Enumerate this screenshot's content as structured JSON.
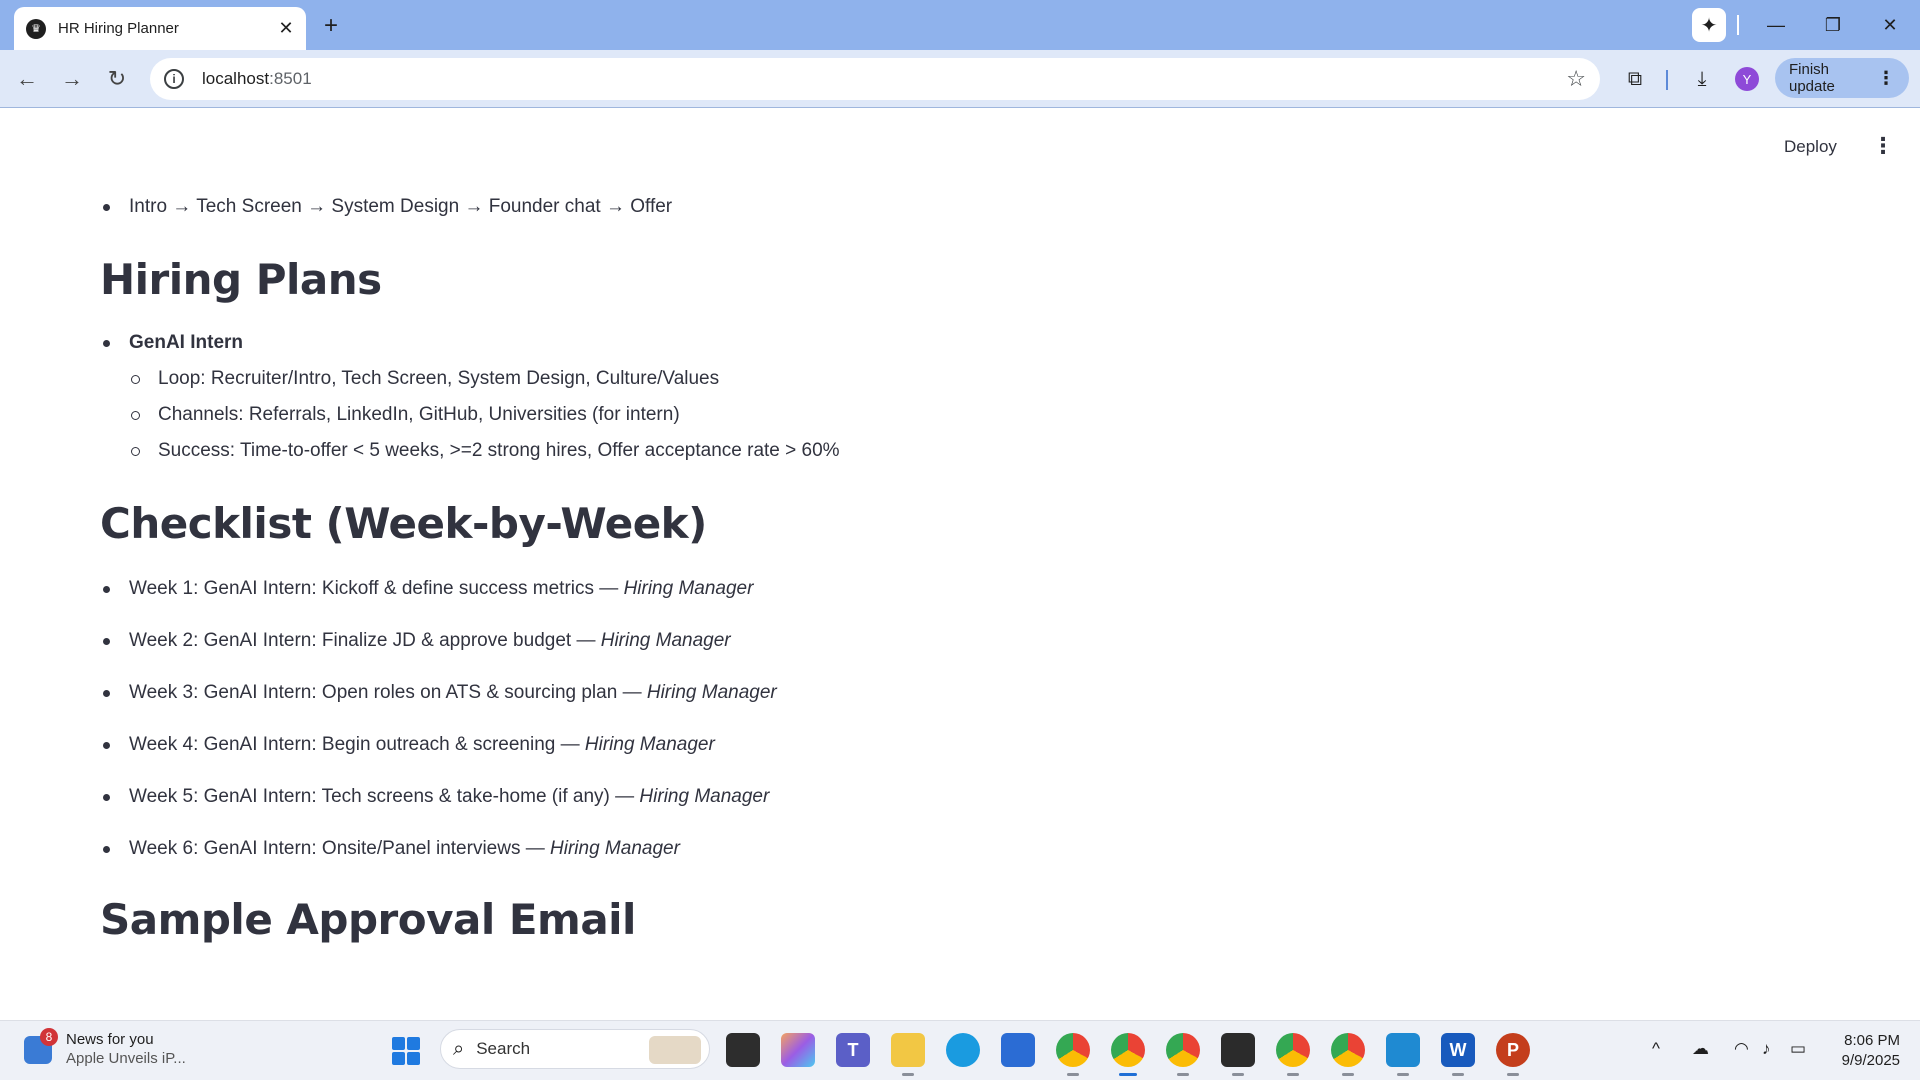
{
  "browser": {
    "tab_title": "HR Hiring Planner",
    "url_host": "localhost",
    "url_port": ":8501",
    "finish_update_label": "Finish update",
    "profile_initial": "Y"
  },
  "app": {
    "deploy_label": "Deploy",
    "process_line": "Intro → Tech Screen → System Design → Founder chat → Offer",
    "hiring_plans_heading": "Hiring Plans",
    "role_name": "GenAI Intern",
    "role_details": [
      "Loop: Recruiter/Intro, Tech Screen, System Design, Culture/Values",
      "Channels: Referrals, LinkedIn, GitHub, Universities (for intern)",
      "Success: Time-to-offer < 5 weeks, >=2 strong hires, Offer acceptance rate > 60%"
    ],
    "checklist_heading": "Checklist (Week-by-Week)",
    "checklist": [
      {
        "text": "Week 1: GenAI Intern: Kickoff & define success metrics — ",
        "owner": "Hiring Manager"
      },
      {
        "text": "Week 2: GenAI Intern: Finalize JD & approve budget — ",
        "owner": "Hiring Manager"
      },
      {
        "text": "Week 3: GenAI Intern: Open roles on ATS & sourcing plan — ",
        "owner": "Hiring Manager"
      },
      {
        "text": "Week 4: GenAI Intern: Begin outreach & screening — ",
        "owner": "Hiring Manager"
      },
      {
        "text": "Week 5: GenAI Intern: Tech screens & take-home (if any) — ",
        "owner": "Hiring Manager"
      },
      {
        "text": "Week 6: GenAI Intern: Onsite/Panel interviews — ",
        "owner": "Hiring Manager"
      }
    ],
    "email_heading": "Sample Approval Email"
  },
  "taskbar": {
    "news_badge": "8",
    "news_title": "News for you",
    "news_sub": "Apple Unveils iP...",
    "search_label": "Search",
    "time": "8:06 PM",
    "date": "9/9/2025"
  },
  "colors": {
    "tabbar": "#8fb2ec",
    "toolbar": "#dfe8f8",
    "text": "#31333f"
  }
}
